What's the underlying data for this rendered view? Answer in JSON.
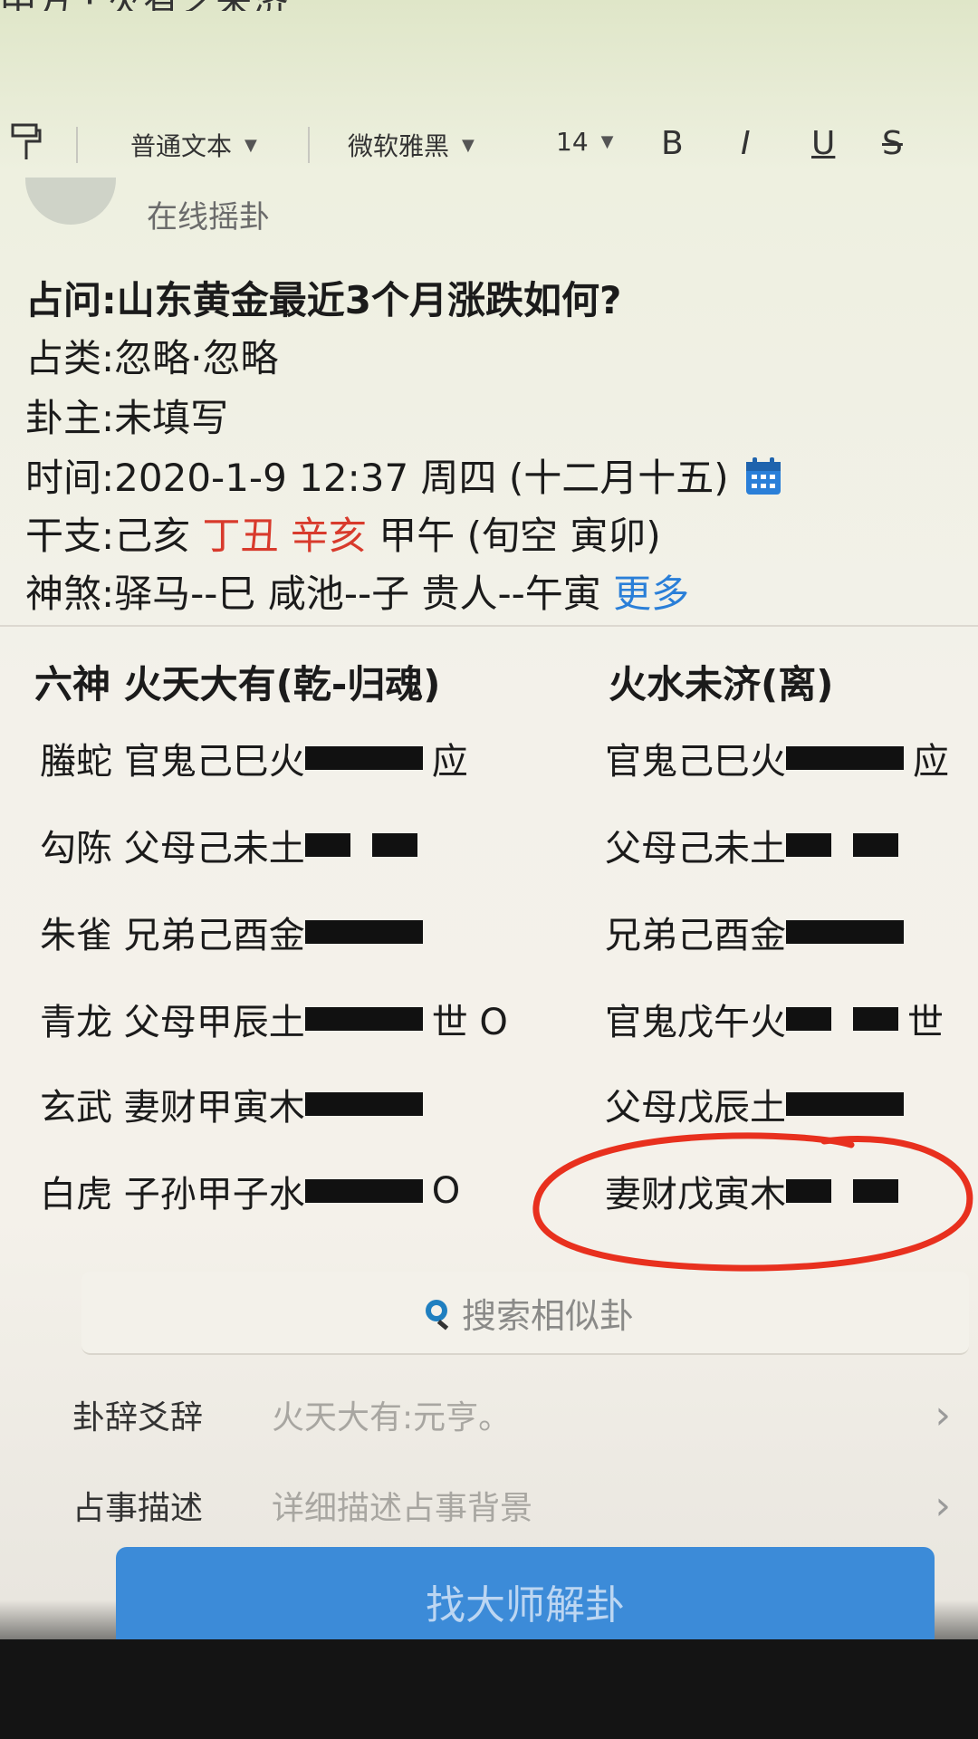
{
  "window": {
    "title_fragment": "中方 · 火有之未济"
  },
  "toolbar": {
    "paragraph_style": "普通文本",
    "font_name": "微软雅黑",
    "font_size": "14",
    "bold": "B",
    "italic": "I",
    "underline": "U",
    "strikethrough": "S"
  },
  "app": {
    "name": "在线摇卦"
  },
  "info": {
    "question_label": "占问:",
    "question": "山东黄金最近3个月涨跌如何?",
    "category_label": "占类:",
    "category": "忽略·忽略",
    "owner_label": "卦主:",
    "owner": "未填写",
    "time_label": "时间:",
    "time": "2020-1-9 12:37 周四 (十二月十五)",
    "ganzhi_label": "干支:",
    "ganzhi_1": "己亥",
    "ganzhi_2": "丁丑 辛亥",
    "ganzhi_3": "甲午 (旬空 寅卯)",
    "shensha_label": "神煞:",
    "shensha": "驿马--巳  咸池--子  贵人--午寅",
    "more": "更多"
  },
  "hexagrams": {
    "left_header": "六神 火天大有(乾-归魂)",
    "right_header": "火水未济(离)",
    "left_lines": [
      {
        "text": "螣蛇 官鬼己巳火",
        "type": "yang",
        "mark": "应"
      },
      {
        "text": "勾陈 父母己未土",
        "type": "yin",
        "mark": ""
      },
      {
        "text": "朱雀 兄弟己酉金",
        "type": "yang",
        "mark": ""
      },
      {
        "text": "青龙 父母甲辰土",
        "type": "yang",
        "mark": "世 O"
      },
      {
        "text": "玄武 妻财甲寅木",
        "type": "yang",
        "mark": ""
      },
      {
        "text": "白虎 子孙甲子水",
        "type": "yang",
        "mark": "O"
      }
    ],
    "right_lines": [
      {
        "text": "官鬼己巳火",
        "type": "yang",
        "mark": "应"
      },
      {
        "text": "父母己未土",
        "type": "yin",
        "mark": ""
      },
      {
        "text": "兄弟己酉金",
        "type": "yang",
        "mark": ""
      },
      {
        "text": "官鬼戊午火",
        "type": "yin",
        "mark": "世"
      },
      {
        "text": "父母戊辰土",
        "type": "yang",
        "mark": ""
      },
      {
        "text": "妻财戊寅木",
        "type": "yin",
        "mark": ""
      }
    ]
  },
  "actions": {
    "search_similar": "搜索相似卦",
    "gua_ci_label": "卦辞爻辞",
    "gua_ci_value": "火天大有:元亨。",
    "describe_label": "占事描述",
    "describe_placeholder": "详细描述占事背景",
    "find_master": "找大师解卦"
  },
  "colors": {
    "accent_blue": "#2a7fd8",
    "highlight_red": "#d83a2c",
    "button_blue": "#3c8bd8",
    "annotation_red": "#e8301e"
  }
}
